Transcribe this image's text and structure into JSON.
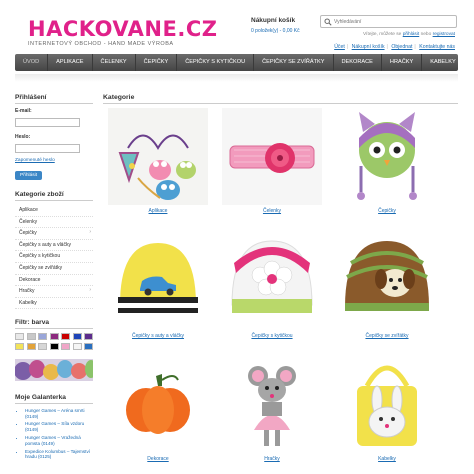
{
  "header": {
    "logo_title": "HACKOVANE.CZ",
    "logo_subtitle": "INTERNETOVÝ OBCHOD - HAND MADE VÝROBA",
    "cart_title": "Nákupní košík",
    "cart_value": "0 položek(y) - 0,00 Kč",
    "search_placeholder": "Vyhledávání",
    "login_prefix": "Vítejte, můžete se",
    "login_link": "přihlásit",
    "login_middle": "nebo",
    "register_link": "registrovat"
  },
  "usernav": [
    "Účet",
    "Nákupní košík",
    "Objednat",
    "Kontaktujte nás"
  ],
  "menu": [
    "ÚVOD",
    "APLIKACE",
    "ČELENKY",
    "ČEPIČKY",
    "ČEPIČKY S KYTIČKOU",
    "ČEPIČKY SE ZVÍŘÁTKY",
    "DEKORACE",
    "HRAČKY",
    "KABELKY"
  ],
  "login": {
    "title": "Přihlášení",
    "email_label": "E-mail:",
    "password_label": "Heslo:",
    "forgot": "Zapomenuté heslo",
    "button": "Přihlásit"
  },
  "categories": {
    "title": "Kategorie zboží",
    "items": [
      {
        "label": "Aplikace",
        "arrow": ""
      },
      {
        "label": "Čelenky",
        "arrow": ""
      },
      {
        "label": "Čepičky",
        "arrow": "›"
      },
      {
        "label": "Čepičky s auty a vláčky",
        "arrow": ""
      },
      {
        "label": "Čepičky s kytičkou",
        "arrow": ""
      },
      {
        "label": "Čepičky se zvířátky",
        "arrow": ""
      },
      {
        "label": "Dekorace",
        "arrow": ""
      },
      {
        "label": "Hračky",
        "arrow": "›"
      },
      {
        "label": "Kabelky",
        "arrow": ""
      }
    ]
  },
  "filter": {
    "title": "Filtr: barva",
    "colors": [
      "#e8e8e8",
      "#c8c8c8",
      "#9aa6d9",
      "#8c2a7e",
      "#c90000",
      "#1e44b8",
      "#5c2c8c",
      "#f2e35a",
      "#e2a33a",
      "#d6d6d6",
      "#000000",
      "#f0a7c8",
      "#f5f5f5",
      "#2a6fbf"
    ]
  },
  "gallery": {
    "title": "Moje Galanterka",
    "items": [
      "Hunger Games – Aréna smrti (0149)",
      "Hunger Games – Síla vzdoru (0149)",
      "Hunger Games – Vražedná pomsta (0149)",
      "Expedice Kolumbus – Tajemství hradu (0125)"
    ]
  },
  "main": {
    "title": "Kategorie",
    "products": [
      {
        "label": "Aplikace",
        "image": "crochet-appliques-image"
      },
      {
        "label": "Čelenky",
        "image": "pink-headband-image"
      },
      {
        "label": "Čepičky",
        "image": "owl-hat-image"
      },
      {
        "label": "Čepičky s auty a vláčky",
        "image": "car-hat-image"
      },
      {
        "label": "Čepičky s kytičkou",
        "image": "flower-hat-image"
      },
      {
        "label": "Čepičky se zvířátky",
        "image": "dog-hat-image"
      },
      {
        "label": "Dekorace",
        "image": "pumpkin-image"
      },
      {
        "label": "Hračky",
        "image": "mouse-toy-image"
      },
      {
        "label": "Kabelky",
        "image": "bunny-bag-image"
      }
    ]
  }
}
